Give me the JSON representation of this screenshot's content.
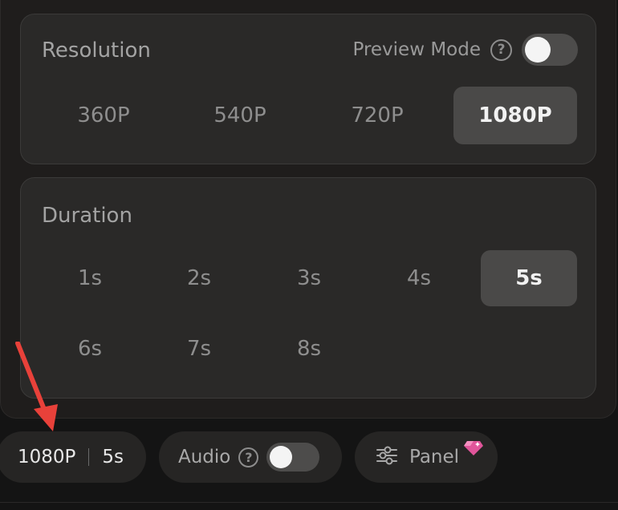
{
  "resolution": {
    "title": "Resolution",
    "preview_mode_label": "Preview Mode",
    "preview_mode_on": false,
    "options": [
      "360P",
      "540P",
      "720P",
      "1080P"
    ],
    "selected": "1080P"
  },
  "duration": {
    "title": "Duration",
    "options_row1": [
      "1s",
      "2s",
      "3s",
      "4s",
      "5s"
    ],
    "options_row2": [
      "6s",
      "7s",
      "8s"
    ],
    "selected": "5s"
  },
  "bottom_bar": {
    "resolution_value": "1080P",
    "duration_value": "5s",
    "audio_label": "Audio",
    "audio_on": false,
    "panel_label": "Panel"
  },
  "colors": {
    "annotation_arrow": "#e8413a",
    "selected_bg": "#4a4948",
    "gem_pink": "#e0559a"
  },
  "icons": [
    "help-icon",
    "sliders-icon",
    "gem-icon"
  ]
}
